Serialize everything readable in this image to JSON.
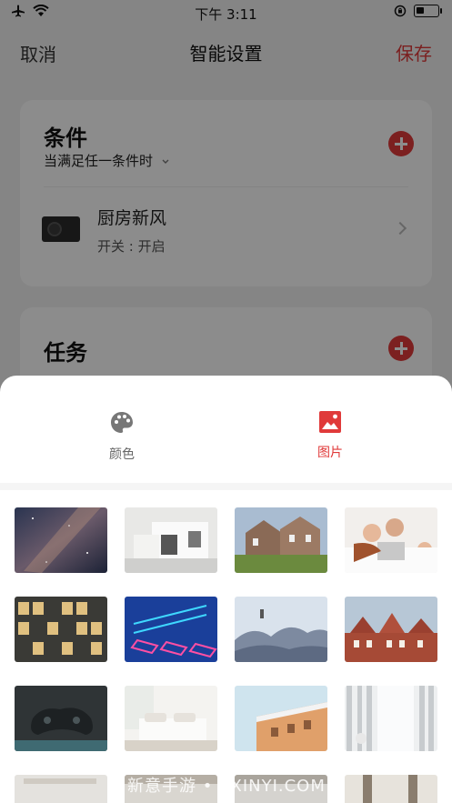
{
  "status_bar": {
    "time": "下午 3:11"
  },
  "nav": {
    "cancel": "取消",
    "title": "智能设置",
    "save": "保存"
  },
  "condition": {
    "title": "条件",
    "mode": "当满足任一条件时",
    "device_name": "厨房新风",
    "device_status": "开关 : 开启"
  },
  "task": {
    "title": "任务"
  },
  "sheet": {
    "tabs": [
      {
        "label": "颜色",
        "icon": "palette-icon",
        "selected": false
      },
      {
        "label": "图片",
        "icon": "image-icon",
        "selected": true
      }
    ],
    "thumbnails": [
      {
        "name": "starry-sky"
      },
      {
        "name": "white-modern-house"
      },
      {
        "name": "brick-house-lawn"
      },
      {
        "name": "family-laptop"
      },
      {
        "name": "glass-office-building"
      },
      {
        "name": "neon-keyboard"
      },
      {
        "name": "foggy-mountains"
      },
      {
        "name": "red-brick-townhouses"
      },
      {
        "name": "gaming-controller"
      },
      {
        "name": "white-bedroom"
      },
      {
        "name": "orange-building"
      },
      {
        "name": "curtains-window"
      },
      {
        "name": "interior-1"
      },
      {
        "name": "interior-2"
      },
      {
        "name": "interior-3"
      },
      {
        "name": "interior-4"
      }
    ]
  },
  "watermark": "新意手游 • SXINYI.COM",
  "colors": {
    "accent": "#e03a3a"
  }
}
